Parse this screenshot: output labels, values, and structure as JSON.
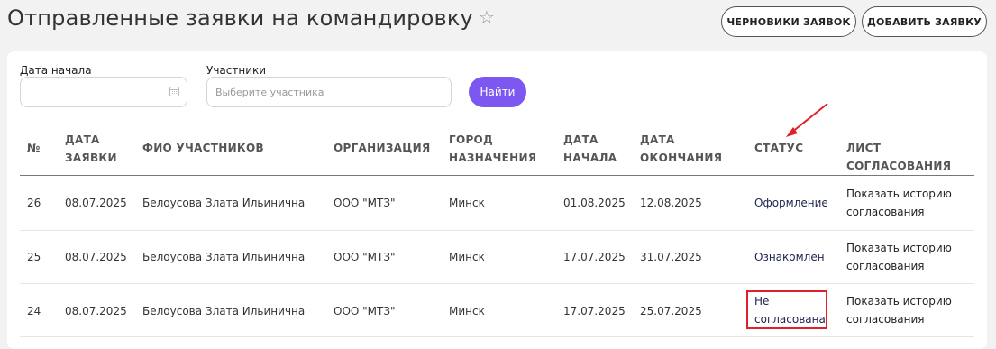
{
  "page": {
    "title": "Отправленные заявки на командировку",
    "star_icon": "star-icon"
  },
  "header_buttons": {
    "drafts": "ЧЕРНОВИКИ ЗАЯВОК",
    "add": "ДОБАВИТЬ ЗАЯВКУ"
  },
  "filters": {
    "date_label": "Дата начала",
    "date_value": "",
    "calendar_icon": "calendar-icon",
    "participants_label": "Участники",
    "participants_placeholder": "Выберите участника",
    "search_button": "Найти"
  },
  "table": {
    "columns": {
      "num": "№",
      "request_date_1": "ДАТА",
      "request_date_2": "ЗАЯВКИ",
      "participants": "ФИО УЧАСТНИКОВ",
      "org": "ОРГАНИЗАЦИЯ",
      "city_1": "ГОРОД",
      "city_2": "НАЗНАЧЕНИЯ",
      "start_1": "ДАТА",
      "start_2": "НАЧАЛА",
      "end_1": "ДАТА",
      "end_2": "ОКОНЧАНИЯ",
      "status": "СТАТУС",
      "approval": "ЛИСТ СОГЛАСОВАНИЯ"
    },
    "rows": [
      {
        "num": "26",
        "request_date": "08.07.2025",
        "participants": "Белоусова Злата Ильинична",
        "org": "ООО \"МТЗ\"",
        "city": "Минск",
        "start": "01.08.2025",
        "end": "12.08.2025",
        "status_1": "Оформление",
        "status_2": "",
        "approval_1": "Показать историю",
        "approval_2": "согласования"
      },
      {
        "num": "25",
        "request_date": "08.07.2025",
        "participants": "Белоусова Злата Ильинична",
        "org": "ООО \"МТЗ\"",
        "city": "Минск",
        "start": "17.07.2025",
        "end": "31.07.2025",
        "status_1": "Ознакомлен",
        "status_2": "",
        "approval_1": "Показать историю",
        "approval_2": "согласования"
      },
      {
        "num": "24",
        "request_date": "08.07.2025",
        "participants": "Белоусова Злата Ильинична",
        "org": "ООО \"МТЗ\"",
        "city": "Минск",
        "start": "17.07.2025",
        "end": "25.07.2025",
        "status_1": "Не",
        "status_2": "согласована",
        "approval_1": "Показать историю",
        "approval_2": "согласования"
      }
    ]
  },
  "annotation": {
    "highlight_color": "#e0202a"
  }
}
